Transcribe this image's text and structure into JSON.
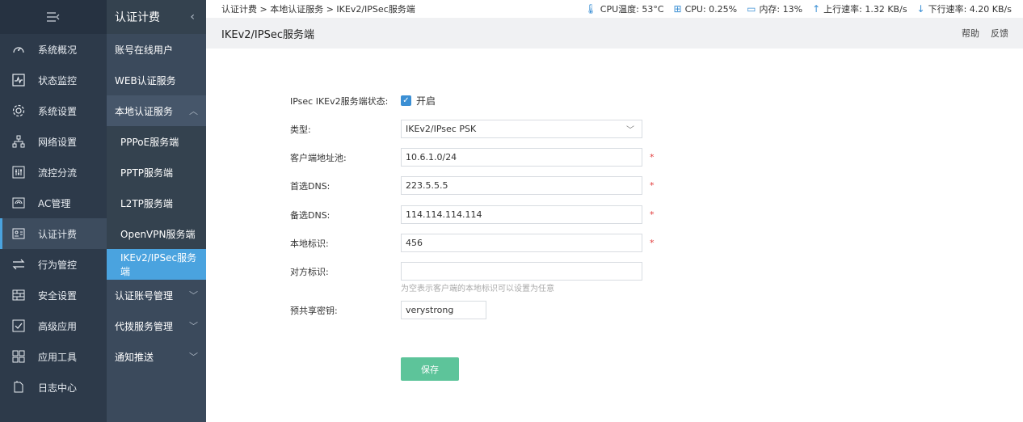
{
  "nav1": {
    "toggle_icon": "menu-collapse-icon",
    "items": [
      {
        "label": "系统概况",
        "icon": "gauge-icon"
      },
      {
        "label": "状态监控",
        "icon": "pulse-icon"
      },
      {
        "label": "系统设置",
        "icon": "gear-icon"
      },
      {
        "label": "网络设置",
        "icon": "network-icon"
      },
      {
        "label": "流控分流",
        "icon": "sliders-icon"
      },
      {
        "label": "AC管理",
        "icon": "router-icon"
      },
      {
        "label": "认证计费",
        "icon": "id-card-icon"
      },
      {
        "label": "行为管控",
        "icon": "arrows-icon"
      },
      {
        "label": "安全设置",
        "icon": "firewall-icon"
      },
      {
        "label": "高级应用",
        "icon": "check-box-icon"
      },
      {
        "label": "应用工具",
        "icon": "apps-icon"
      },
      {
        "label": "日志中心",
        "icon": "document-icon"
      }
    ]
  },
  "nav2": {
    "title": "认证计费",
    "items": [
      {
        "label": "账号在线用户"
      },
      {
        "label": "WEB认证服务"
      },
      {
        "label": "本地认证服务"
      },
      {
        "label": "PPPoE服务端"
      },
      {
        "label": "PPTP服务端"
      },
      {
        "label": "L2TP服务端"
      },
      {
        "label": "OpenVPN服务端"
      },
      {
        "label": "IKEv2/IPSec服务端"
      },
      {
        "label": "认证账号管理"
      },
      {
        "label": "代拨服务管理"
      },
      {
        "label": "通知推送"
      }
    ]
  },
  "breadcrumb": "认证计费 > 本地认证服务 > IKEv2/IPSec服务端",
  "stats": {
    "cpu_temp": "CPU温度: 53°C",
    "cpu": "CPU: 0.25%",
    "memory": "内存: 13%",
    "upload": "上行速率: 1.32 KB/s",
    "download": "下行速率: 4.20 KB/s"
  },
  "page_title": "IKEv2/IPSec服务端",
  "links": {
    "help": "帮助",
    "feedback": "反馈"
  },
  "form": {
    "status_label": "IPsec IKEv2服务端状态:",
    "status_value": "开启",
    "type_label": "类型:",
    "type_value": "IKEv2/IPsec PSK",
    "pool_label": "客户端地址池:",
    "pool_value": "10.6.1.0/24",
    "dns1_label": "首选DNS:",
    "dns1_value": "223.5.5.5",
    "dns2_label": "备选DNS:",
    "dns2_value": "114.114.114.114",
    "local_id_label": "本地标识:",
    "local_id_value": "456",
    "remote_id_label": "对方标识:",
    "remote_id_value": "",
    "remote_id_hint": "为空表示客户端的本地标识可以设置为任意",
    "psk_label": "预共享密钥:",
    "psk_value": "verystrong",
    "required_mark": "*",
    "save_label": "保存"
  },
  "colors": {
    "accent": "#4aa3df",
    "save": "#5dc49a",
    "required": "#e23a3a"
  }
}
